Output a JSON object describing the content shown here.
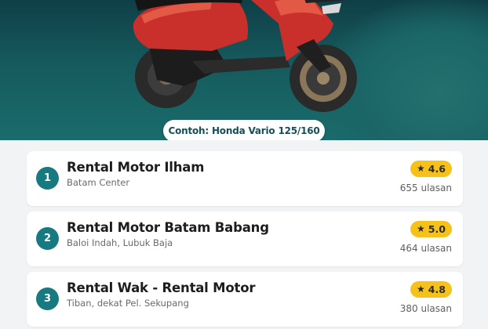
{
  "hero": {
    "caption": "Contoh: Honda Vario 125/160"
  },
  "rentals": [
    {
      "rank": "1",
      "name": "Rental Motor Ilham",
      "location": "Batam Center",
      "rating": "4.6",
      "reviews": "655 ulasan"
    },
    {
      "rank": "2",
      "name": "Rental Motor Batam Babang",
      "location": "Baloi Indah, Lubuk Baja",
      "rating": "5.0",
      "reviews": "464 ulasan"
    },
    {
      "rank": "3",
      "name": "Rental Wak - Rental Motor",
      "location": "Tiban, dekat Pel. Sekupang",
      "rating": "4.8",
      "reviews": "380 ulasan"
    }
  ],
  "colors": {
    "accent": "#177a80",
    "rating_badge": "#f6c21a",
    "scooter_body": "#c9302c"
  },
  "icons": {
    "rating": "star-icon"
  }
}
